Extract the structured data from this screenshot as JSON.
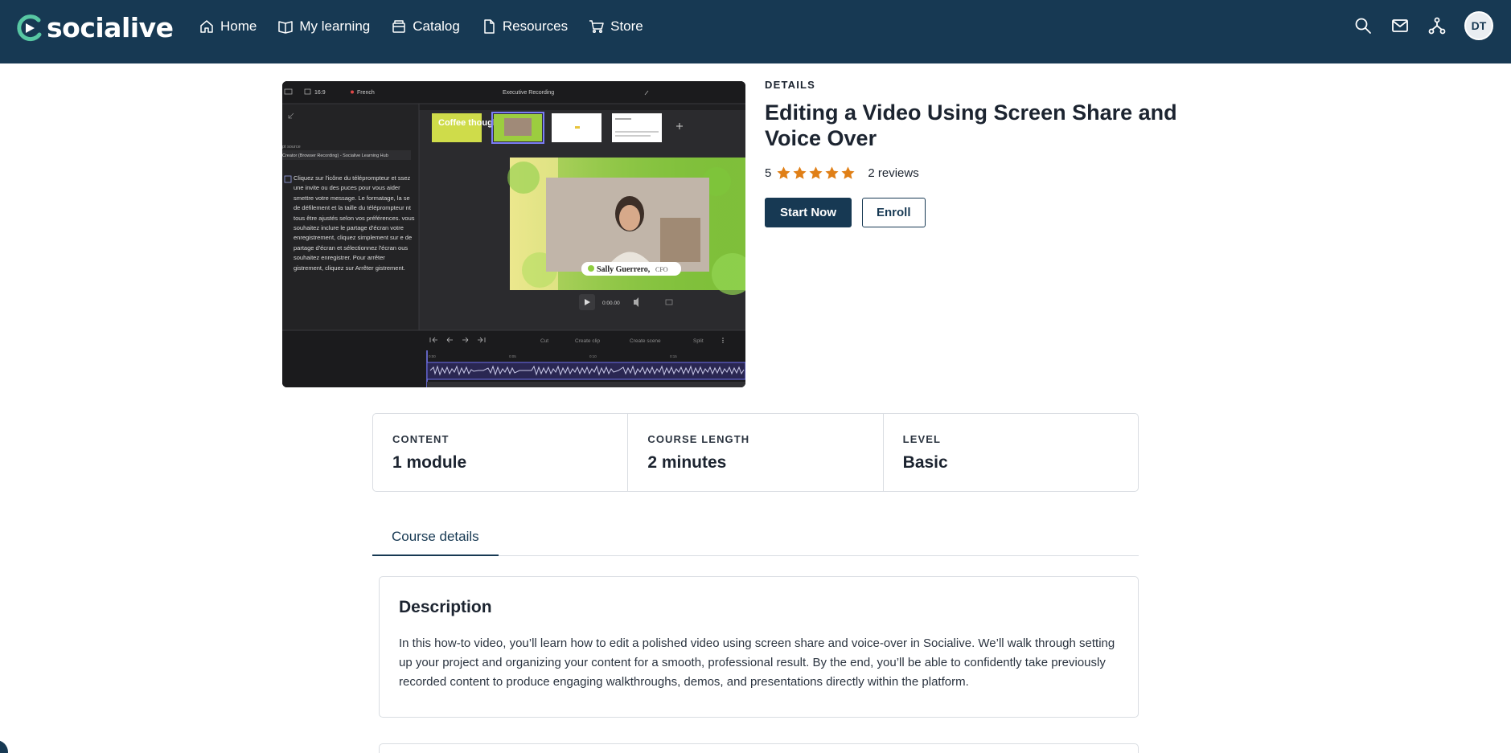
{
  "brand": {
    "name": "socialive",
    "accent": "#58c7a3",
    "navbar_color": "#173953"
  },
  "nav": {
    "items": [
      {
        "label": "Home",
        "icon": "home-icon"
      },
      {
        "label": "My learning",
        "icon": "book-icon"
      },
      {
        "label": "Catalog",
        "icon": "catalog-icon"
      },
      {
        "label": "Resources",
        "icon": "document-icon"
      },
      {
        "label": "Store",
        "icon": "cart-icon"
      }
    ],
    "right_icons": [
      "search-icon",
      "mail-icon",
      "org-chart-icon"
    ],
    "avatar_initials": "DT"
  },
  "thumbnail": {
    "topbar_left": "16:9",
    "language": "French",
    "recording_title": "Executive Recording",
    "source_label": "pt source",
    "source_value": "Creator (Browser Recording) - Socialive Learning Hub",
    "teleprompter_text": "Cliquez sur l'icône du téléprompteur et ssez une invite ou des puces pour vous aider smettre votre message. Le formatage, la se de défilement et la taille du téléprompteur nt tous être ajustés selon vos préférences. vous souhaitez inclure le partage d'écran votre enregistrement, cliquez simplement sur e de partage d'écran et sélectionnez l'écran ous souhaitez enregistrer. Pour arrêter gistrement, cliquez sur Arrêter gistrement.",
    "slide1_text": "Coffee thoughts",
    "lower_third_name": "Sally Guerrero,",
    "lower_third_role": "CFO",
    "timecode": "0:00.00",
    "timeline_tools": [
      "Cut",
      "Create clip",
      "Create scene",
      "Split"
    ],
    "timeline_marks": [
      "0:00",
      "0:05",
      "0:10",
      "0:15"
    ]
  },
  "course": {
    "kicker": "DETAILS",
    "title": "Editing a Video Using Screen Share and Voice Over",
    "rating": "5",
    "star_color": "#e07f16",
    "reviews": "2 reviews",
    "start_label": "Start Now",
    "enroll_label": "Enroll"
  },
  "stats": [
    {
      "label": "CONTENT",
      "value": "1 module"
    },
    {
      "label": "COURSE LENGTH",
      "value": "2 minutes"
    },
    {
      "label": "LEVEL",
      "value": "Basic"
    }
  ],
  "tabs": {
    "active": "Course details"
  },
  "description": {
    "heading": "Description",
    "body": "In this how-to video, you’ll learn how to edit a polished video using screen share and voice-over in Socialive. We’ll walk through setting up your project and organizing your content for a smooth, professional result. By the end, you’ll be able to confidently take previously recorded content to produce engaging walkthroughs, demos, and presentations directly within the platform."
  }
}
